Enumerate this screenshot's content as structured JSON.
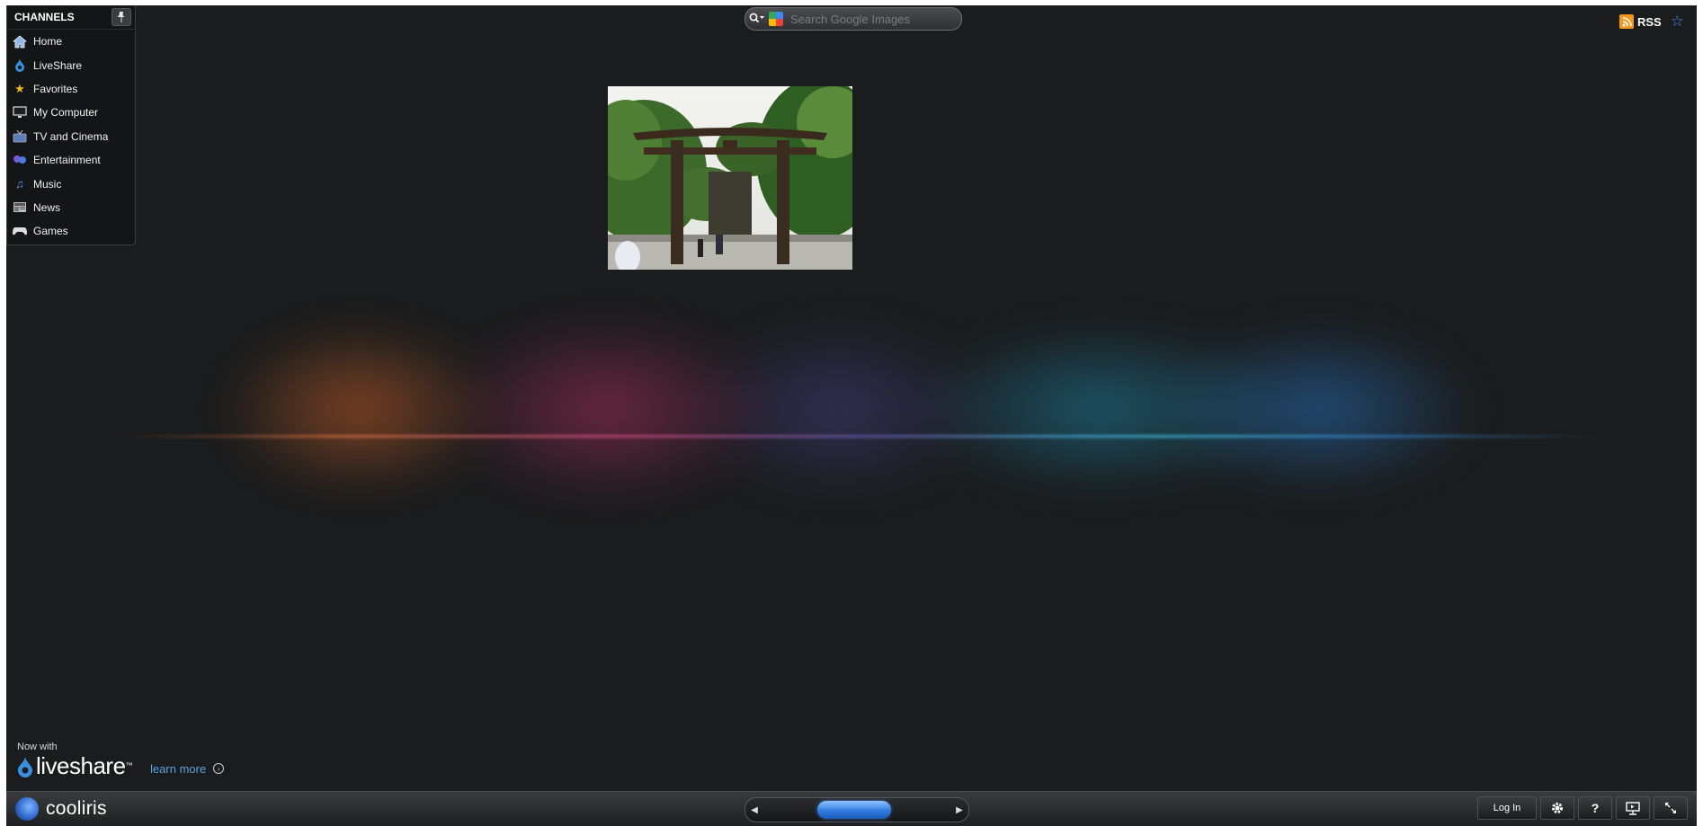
{
  "channels": {
    "title": "CHANNELS",
    "items": [
      {
        "label": "Home",
        "icon": "home-icon"
      },
      {
        "label": "LiveShare",
        "icon": "liveshare-icon"
      },
      {
        "label": "Favorites",
        "icon": "star-icon"
      },
      {
        "label": "My Computer",
        "icon": "monitor-icon"
      },
      {
        "label": "TV and Cinema",
        "icon": "tv-icon"
      },
      {
        "label": "Entertainment",
        "icon": "entertainment-icon"
      },
      {
        "label": "Music",
        "icon": "music-note-icon"
      },
      {
        "label": "News",
        "icon": "newspaper-icon"
      },
      {
        "label": "Games",
        "icon": "gamepad-icon"
      }
    ]
  },
  "search": {
    "placeholder": "Search Google Images",
    "value": ""
  },
  "rss": {
    "label": "RSS"
  },
  "photo": {
    "subject": "torii gate at shrine entrance"
  },
  "promo": {
    "now_with": "Now with",
    "brand": "liveshare",
    "tm": "™",
    "learn_more": "learn more"
  },
  "bottom_bar": {
    "brand": "cooliris",
    "login_label": "Log In",
    "help_label": "?"
  },
  "colors": {
    "accent": "#2f7ce0",
    "rss": "#f39a1e",
    "background": "#1b1c1d"
  }
}
